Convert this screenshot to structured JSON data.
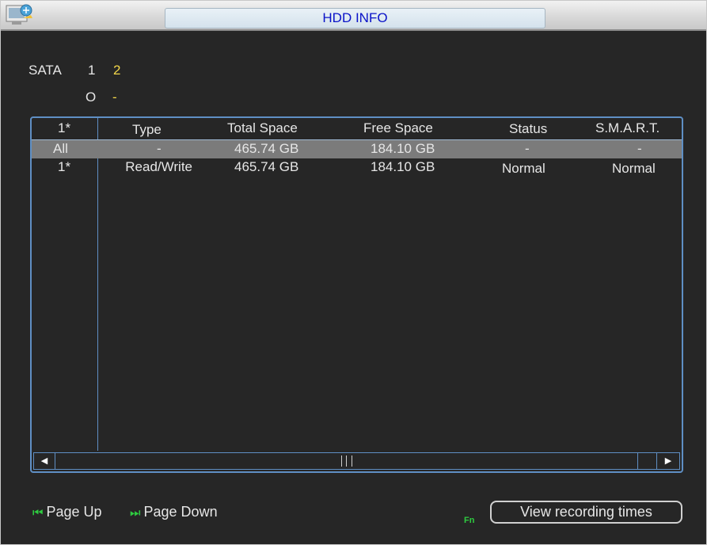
{
  "window": {
    "title": "HDD INFO",
    "icon": "hdd-info-app-icon"
  },
  "sata": {
    "label": "SATA",
    "ports": [
      "1",
      "2"
    ],
    "status": [
      "O",
      "-"
    ]
  },
  "table": {
    "headers": [
      "1*",
      "Type",
      "Total Space",
      "Free Space",
      "Status",
      "S.M.A.R.T."
    ],
    "rows": [
      [
        "All",
        "-",
        "465.74 GB",
        "184.10 GB",
        "-",
        "-"
      ],
      [
        "1*",
        "Read/Write",
        "465.74 GB",
        "184.10 GB",
        "Normal",
        "Normal"
      ]
    ],
    "selected_row": 0
  },
  "scrollbar": {
    "left_icon": "scroll-left-icon",
    "right_icon": "scroll-right-icon"
  },
  "footer": {
    "page_up": "Page Up",
    "page_down": "Page Down",
    "fn": "Fn",
    "view_recording_times": "View recording times"
  },
  "colors": {
    "background": "#262626",
    "title_text": "#0a12c8",
    "frame": "#5f8fc4",
    "highlight": "#7b7b7b",
    "accent_green": "#2ecc40",
    "accent_yellow": "#f2d64a"
  }
}
